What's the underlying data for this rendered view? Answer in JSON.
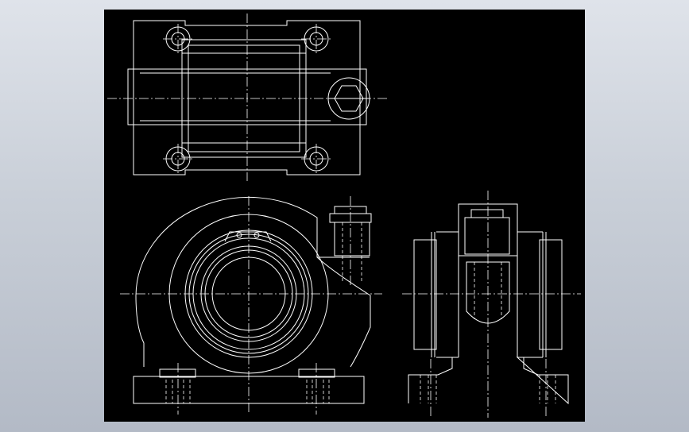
{
  "drawing": {
    "background_color": "#000000",
    "line_color": "#ffffff",
    "views": [
      "top-view",
      "front-view",
      "side-view"
    ]
  }
}
